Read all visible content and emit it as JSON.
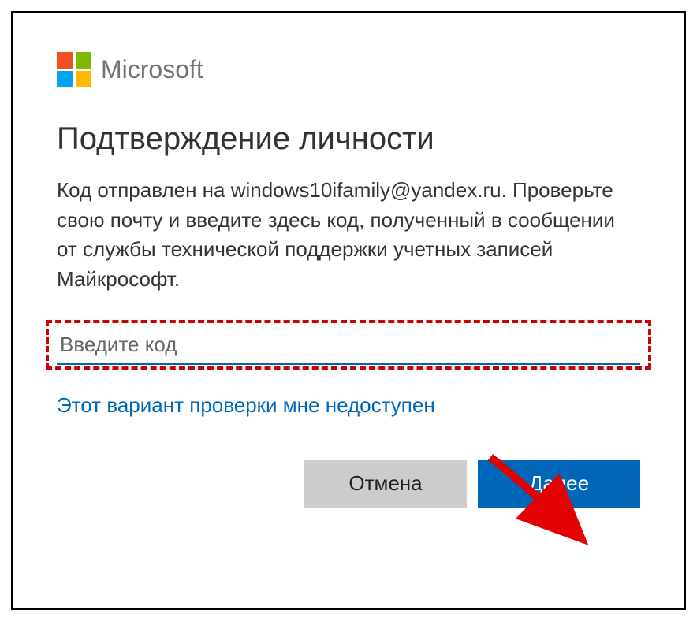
{
  "brand": {
    "name": "Microsoft"
  },
  "dialog": {
    "title": "Подтверждение личности",
    "description": "Код отправлен на windows10ifamily@yandex.ru. Проверьте свою почту и введите здесь код, полученный в сообщении от службы технической поддержки учетных записей Майкрософт."
  },
  "input": {
    "placeholder": "Введите код",
    "value": ""
  },
  "links": {
    "alt_verification": "Этот вариант проверки мне недоступен"
  },
  "buttons": {
    "cancel": "Отмена",
    "next": "Далее"
  },
  "colors": {
    "primary": "#0067b8",
    "highlight_dash": "#cc0000",
    "arrow": "#e20000"
  }
}
